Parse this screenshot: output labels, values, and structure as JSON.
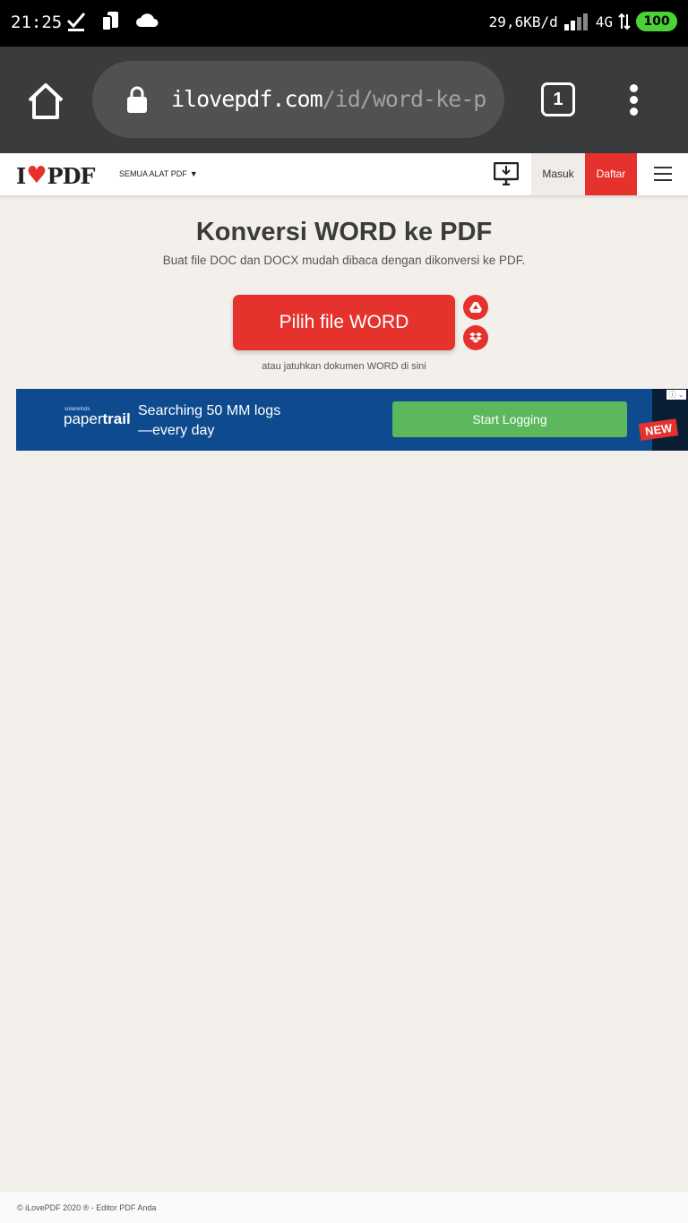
{
  "status_bar": {
    "time": "21:25",
    "network_speed": "29,6KB/d",
    "network_type": "4G",
    "battery": "100"
  },
  "browser": {
    "url_domain": "ilovepdf.com",
    "url_path": "/id/word-ke-p",
    "tab_count": "1"
  },
  "site_nav": {
    "logo_left": "I",
    "logo_right": "PDF",
    "tools_menu": "SEMUA ALAT PDF",
    "login": "Masuk",
    "signup": "Daftar"
  },
  "hero": {
    "title": "Konversi WORD ke PDF",
    "subtitle": "Buat file DOC dan DOCX mudah dibaca dengan dikonversi ke PDF.",
    "pick_button": "Pilih file WORD",
    "drop_hint": "atau jatuhkan dokumen WORD di sini"
  },
  "ad": {
    "brand_small": "solarwinds",
    "brand_light": "paper",
    "brand_bold": "trail",
    "line1": "Searching 50 MM logs",
    "line2": "—every day",
    "cta": "Start Logging",
    "badge": "NEW",
    "info": "ⓘ ⌄"
  },
  "footer": {
    "text": "© iLovePDF 2020 ® - Editor PDF Anda"
  },
  "colors": {
    "brand_red": "#e5322d",
    "page_background": "#f3f0ec",
    "browser_chrome": "#3a3b3c",
    "ad_background": "#0e4b8e",
    "ad_cta": "#5cb85c"
  }
}
